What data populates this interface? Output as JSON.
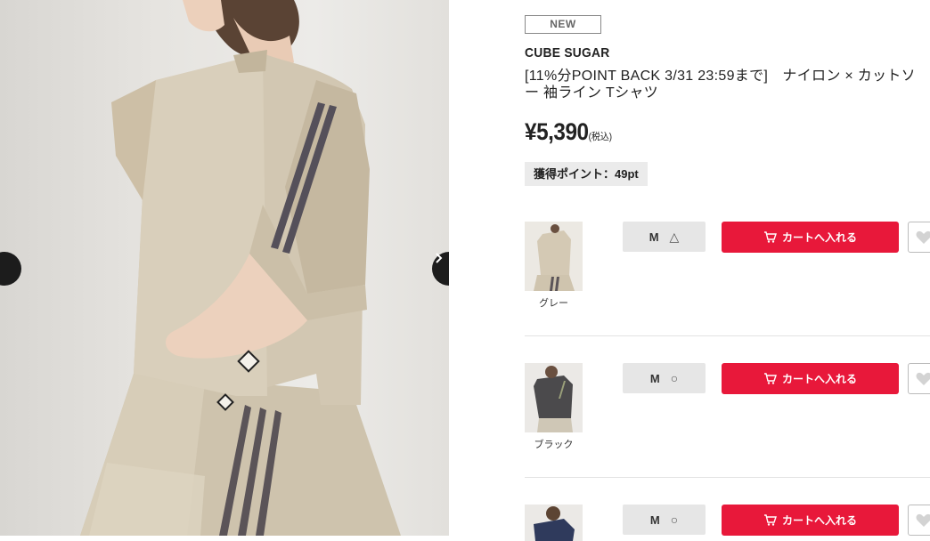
{
  "product": {
    "badge": "NEW",
    "brand": "CUBE SUGAR",
    "title": "[11%分POINT BACK 3/31 23:59まで]　ナイロン × カットソー 袖ライン Tシャツ",
    "price": "¥5,390",
    "price_tax": "(税込)",
    "points": "獲得ポイント：49pt"
  },
  "gallery": {
    "prev_icon": "chevron-left-icon",
    "next_icon": "chevron-right-icon"
  },
  "variants": [
    {
      "color": "グレー",
      "size": "M",
      "stock": "△",
      "cart_label": "カートへ入れる"
    },
    {
      "color": "ブラック",
      "size": "M",
      "stock": "○",
      "cart_label": "カートへ入れる"
    },
    {
      "color": "",
      "size": "M",
      "stock": "○",
      "cart_label": "カートへ入れる"
    }
  ],
  "colors": {
    "cart_red": "#e8183a",
    "badge_gray": "#ebebeb"
  }
}
